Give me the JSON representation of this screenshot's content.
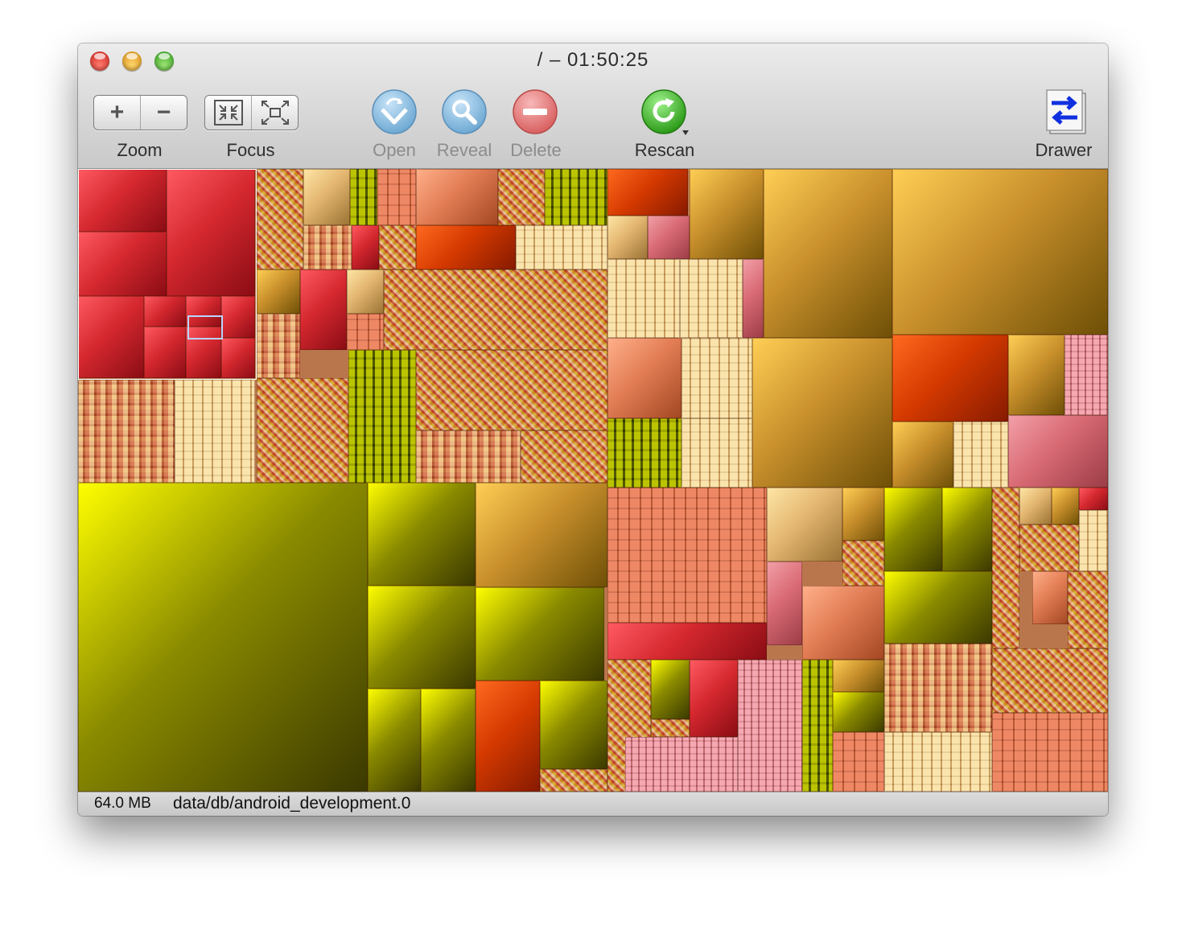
{
  "window": {
    "title": "/ – 01:50:25"
  },
  "toolbar": {
    "zoom": {
      "label": "Zoom",
      "in_symbol": "+",
      "out_symbol": "−"
    },
    "focus": {
      "label": "Focus"
    },
    "open": {
      "label": "Open"
    },
    "reveal": {
      "label": "Reveal"
    },
    "delete": {
      "label": "Delete"
    },
    "rescan": {
      "label": "Rescan"
    },
    "drawer": {
      "label": "Drawer"
    }
  },
  "status": {
    "size": "64.0 MB",
    "path": "data/db/android_development.0"
  },
  "colors": {
    "red": "#d5282f",
    "olive": "#8a8a00",
    "gold": "#c9902c",
    "orange": "#d53a00",
    "pink": "#d86a74",
    "selection": "#b8d4ff"
  }
}
